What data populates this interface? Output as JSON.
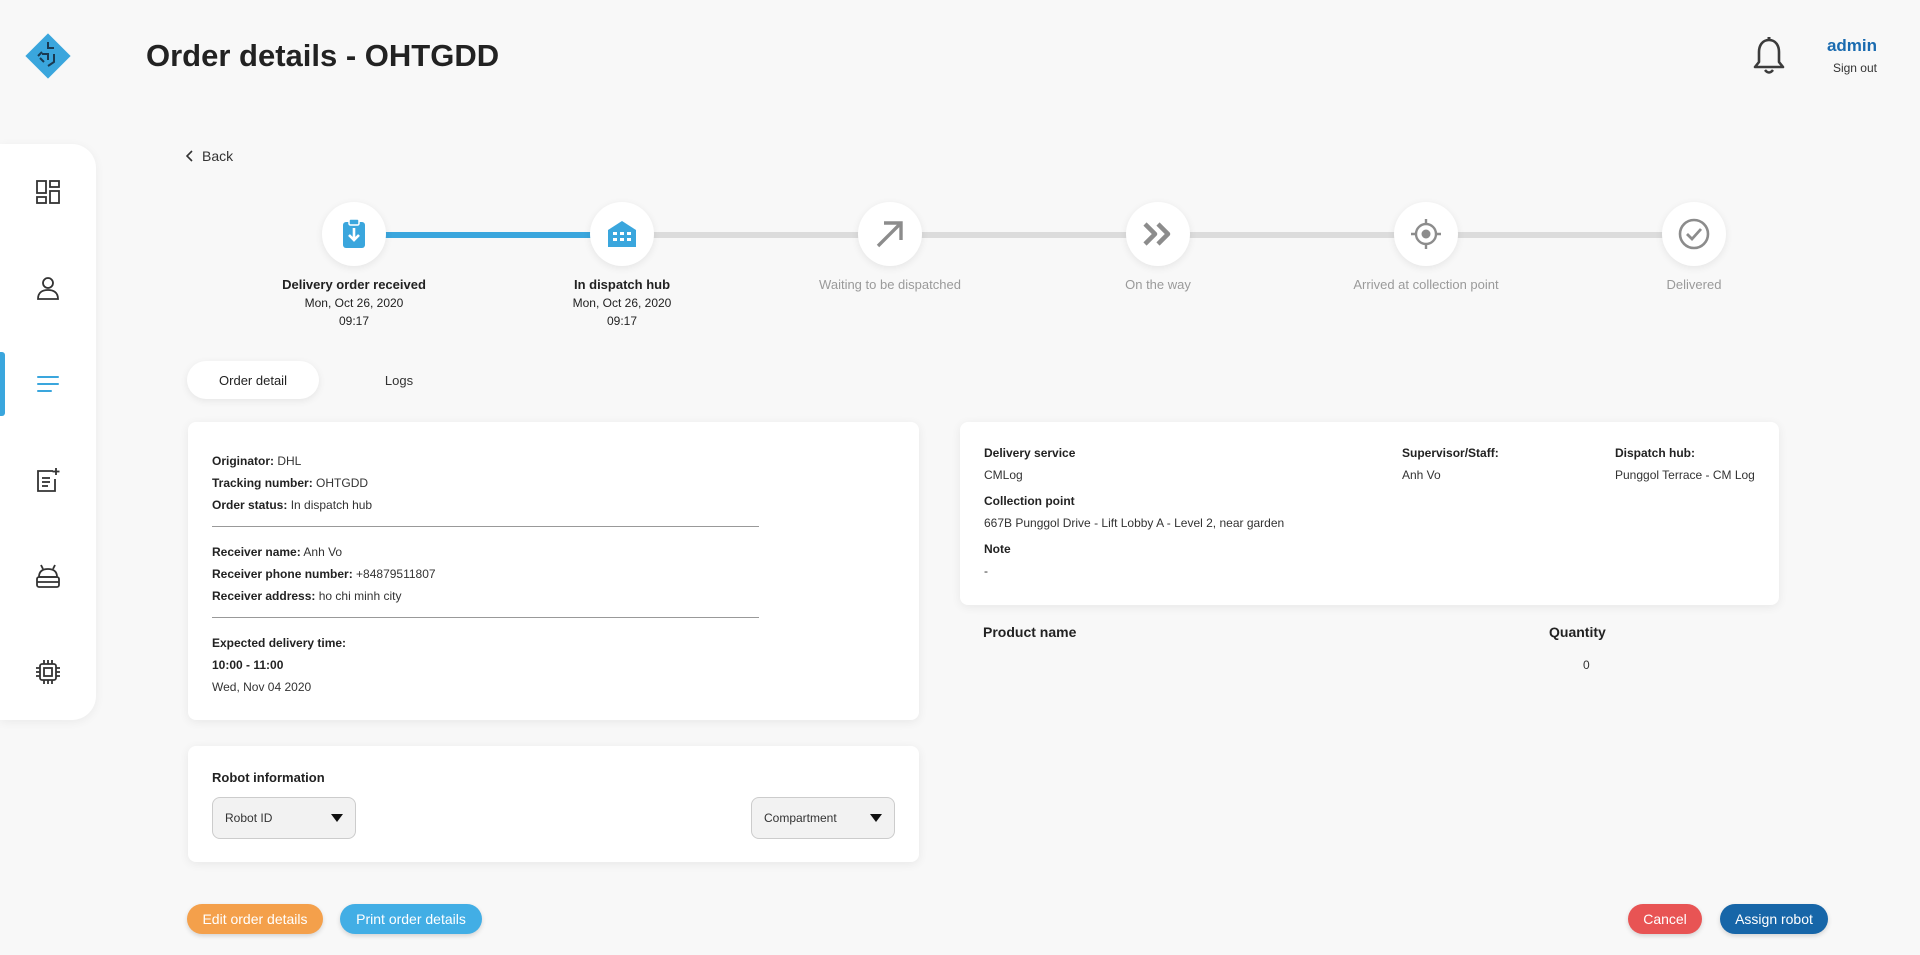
{
  "header": {
    "title": "Order details - OHTGDD",
    "user": "admin",
    "sign_out": "Sign out"
  },
  "sidebar": {
    "items": [
      {
        "icon": "dashboard-icon",
        "active": false
      },
      {
        "icon": "user-icon",
        "active": false
      },
      {
        "icon": "orders-list-icon",
        "active": true
      },
      {
        "icon": "add-order-icon",
        "active": false
      },
      {
        "icon": "robot-icon",
        "active": false
      },
      {
        "icon": "chip-icon",
        "active": false
      }
    ]
  },
  "back_label": "Back",
  "progress": {
    "completed_steps": 2,
    "steps": [
      {
        "label": "Delivery order received",
        "date": "Mon, Oct 26, 2020",
        "time": "09:17",
        "icon": "clipboard-download-icon"
      },
      {
        "label": "In dispatch hub",
        "date": "Mon, Oct 26, 2020",
        "time": "09:17",
        "icon": "warehouse-icon"
      },
      {
        "label": "Waiting to be dispatched",
        "icon": "arrow-up-right-icon"
      },
      {
        "label": "On the way",
        "icon": "double-chevron-right-icon"
      },
      {
        "label": "Arrived at collection point",
        "icon": "location-target-icon"
      },
      {
        "label": "Delivered",
        "icon": "check-circle-icon"
      }
    ]
  },
  "tabs": [
    {
      "label": "Order detail",
      "active": true
    },
    {
      "label": "Logs",
      "active": false
    }
  ],
  "order_info": {
    "originator_label": "Originator:",
    "originator": "DHL",
    "tracking_label": "Tracking number:",
    "tracking": "OHTGDD",
    "status_label": "Order status:",
    "status": "In dispatch hub",
    "receiver_name_label": "Receiver name:",
    "receiver_name": "Anh Vo",
    "receiver_phone_label": "Receiver phone number:",
    "receiver_phone": "+84879511807",
    "receiver_address_label": "Receiver address:",
    "receiver_address": "ho chi minh city",
    "expected_label": "Expected delivery time:",
    "expected_window": "10:00 - 11:00",
    "expected_date": "Wed, Nov 04 2020"
  },
  "delivery_info": {
    "service_label": "Delivery service",
    "service": "CMLog",
    "supervisor_label": "Supervisor/Staff:",
    "supervisor": "Anh Vo",
    "hub_label": "Dispatch hub:",
    "hub": "Punggol Terrace - CM Log",
    "collection_label": "Collection point",
    "collection": "667B Punggol Drive - Lift Lobby A - Level 2, near garden",
    "note_label": "Note",
    "note": "-"
  },
  "products": {
    "name_header": "Product name",
    "quantity_header": "Quantity",
    "quantity_value": "0"
  },
  "robot": {
    "title": "Robot information",
    "robot_id_placeholder": "Robot ID",
    "compartment_placeholder": "Compartment"
  },
  "actions": {
    "edit": "Edit order details",
    "print": "Print order details",
    "cancel": "Cancel",
    "assign": "Assign robot"
  },
  "colors": {
    "accent": "#3aa6dd",
    "edit_button": "#f4a04b",
    "print_button": "#42aee5",
    "cancel_button": "#e85454",
    "assign_button": "#1766a8",
    "user_name": "#1a6bb0"
  }
}
